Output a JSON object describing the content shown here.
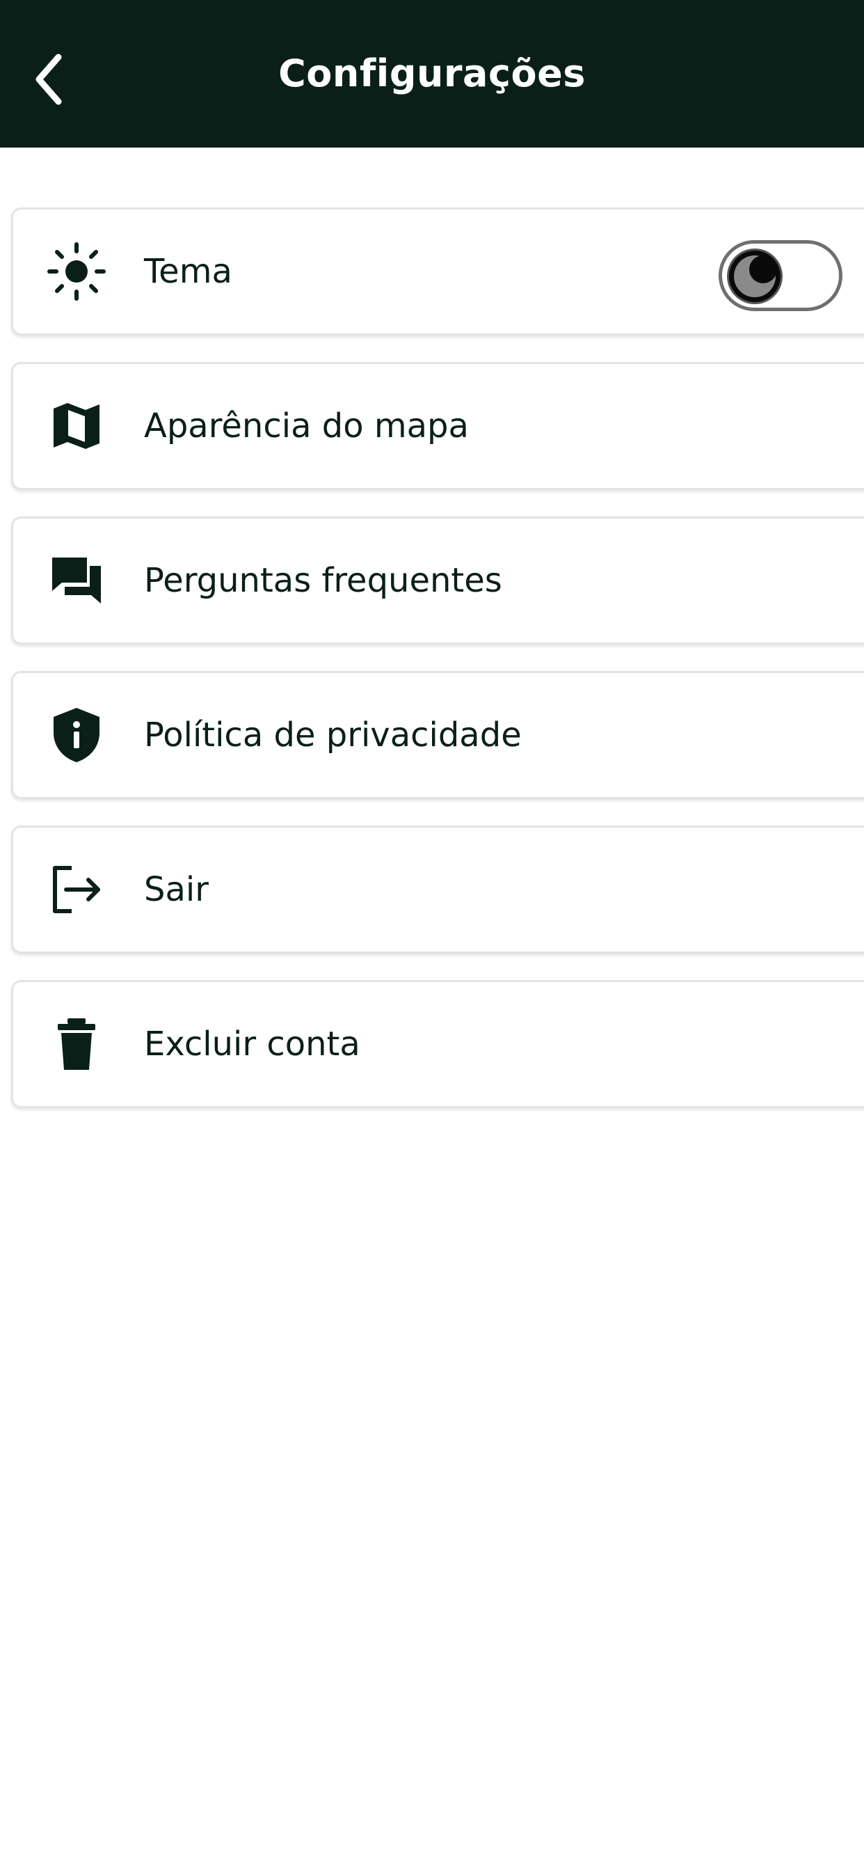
{
  "header": {
    "title": "Configurações",
    "back_icon": "chevron-left-icon"
  },
  "settings": {
    "items": [
      {
        "label": "Tema",
        "icon": "sun-icon",
        "control": "toggle",
        "dark_mode": true
      },
      {
        "label": "Aparência do mapa",
        "icon": "map-icon"
      },
      {
        "label": "Perguntas frequentes",
        "icon": "chat-bubbles-icon"
      },
      {
        "label": "Política de privacidade",
        "icon": "shield-info-icon"
      },
      {
        "label": "Sair",
        "icon": "logout-icon"
      },
      {
        "label": "Excluir conta",
        "icon": "trash-icon"
      }
    ]
  },
  "colors": {
    "header_bg": "#0a1f17",
    "accent": "#0a1f17",
    "card_border": "#e2e4e3"
  }
}
